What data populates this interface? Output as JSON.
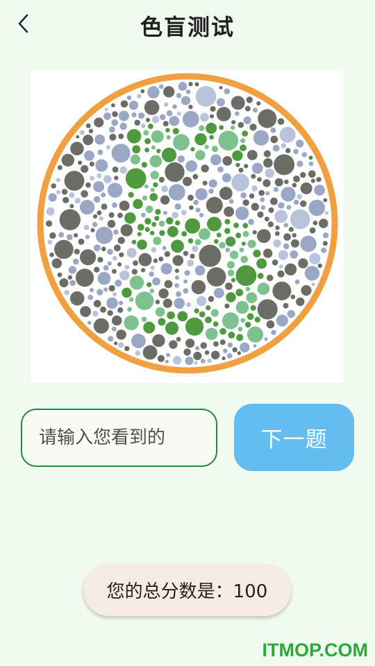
{
  "header": {
    "title": "色盲测试",
    "back_icon": "chevron-left-icon"
  },
  "plate": {
    "icon": "ishihara-plate",
    "ring_color": "#f0a040",
    "figure_color": "#4f9a3e",
    "background_dot_colors": [
      "#6d6d68",
      "#9aa8c6",
      "#b9c4dc"
    ]
  },
  "answer": {
    "placeholder": "请输入您看到的",
    "value": ""
  },
  "next_button": {
    "label": "下一题",
    "color": "#64bdf0"
  },
  "score": {
    "text": "您的总分数是：100"
  },
  "watermark": {
    "text": "ITMOP.COM"
  }
}
